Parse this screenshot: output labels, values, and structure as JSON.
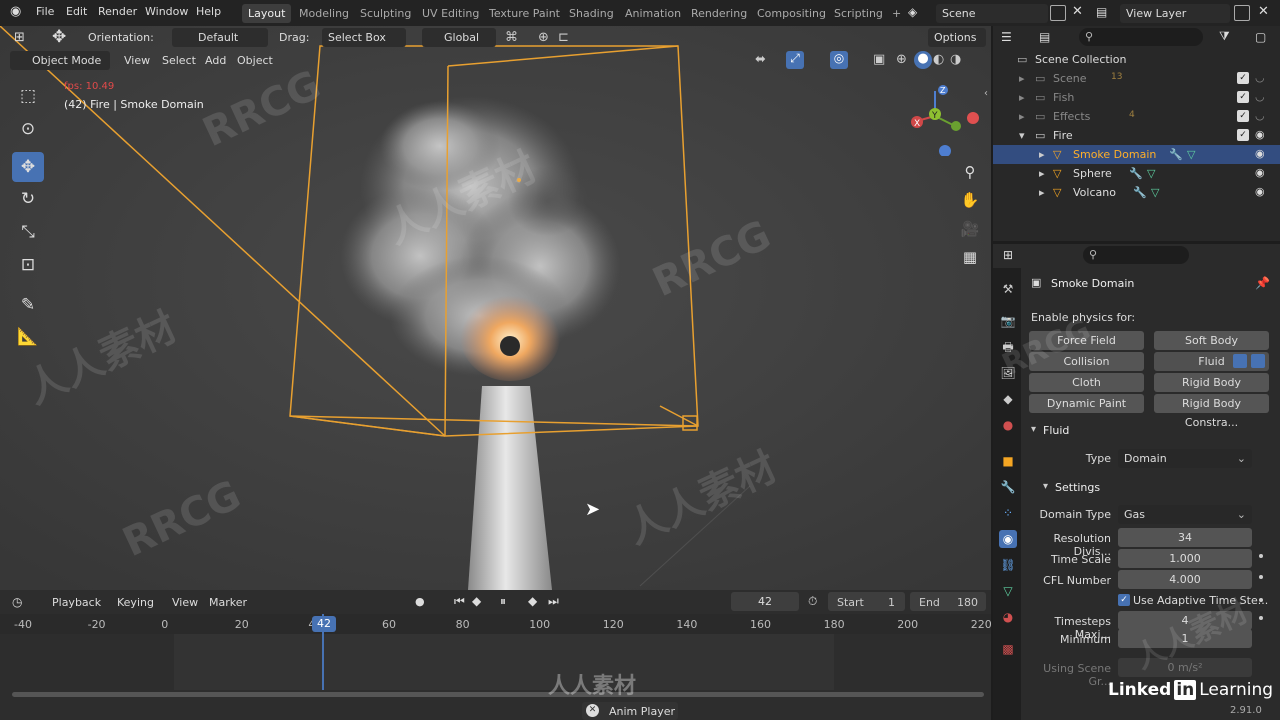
{
  "topbar": {
    "menus": [
      "File",
      "Edit",
      "Render",
      "Window",
      "Help"
    ],
    "workspaces": [
      "Layout",
      "Modeling",
      "Sculpting",
      "UV Editing",
      "Texture Paint",
      "Shading",
      "Animation",
      "Rendering",
      "Compositing",
      "Scripting"
    ],
    "add_label": "+",
    "scene_label": "Scene",
    "viewlayer_label": "View Layer"
  },
  "viewport": {
    "orientation_label": "Orientation:",
    "orientation_value": "Default",
    "drag_label": "Drag:",
    "drag_value": "Select Box",
    "transform_value": "Global",
    "options_label": "Options",
    "mode_label": "Object Mode",
    "menus": [
      "View",
      "Select",
      "Add",
      "Object"
    ],
    "fps_text": "fps: 10.49",
    "object_info": "(42) Fire | Smoke Domain",
    "gizmo": {
      "x": "X",
      "y": "Y",
      "z": "Z"
    }
  },
  "outliner": {
    "search_placeholder": "",
    "rows": [
      {
        "label": "Scene Collection",
        "dim": false,
        "indent": 0
      },
      {
        "label": "Scene",
        "dim": true,
        "indent": 1,
        "badge": "13"
      },
      {
        "label": "Fish",
        "dim": true,
        "indent": 1
      },
      {
        "label": "Effects",
        "dim": true,
        "indent": 1,
        "badge": "4"
      },
      {
        "label": "Fire",
        "dim": false,
        "indent": 1
      },
      {
        "label": "Smoke Domain",
        "dim": false,
        "indent": 2,
        "selected": true
      },
      {
        "label": "Sphere",
        "dim": false,
        "indent": 2
      },
      {
        "label": "Volcano",
        "dim": false,
        "indent": 2
      }
    ]
  },
  "properties": {
    "object_name": "Smoke Domain",
    "enable_physics_label": "Enable physics for:",
    "physics_buttons": [
      "Force Field",
      "Soft Body",
      "Collision",
      "Fluid",
      "Cloth",
      "Rigid Body",
      "Dynamic Paint",
      "Rigid Body Constra..."
    ],
    "fluid_section": "Fluid",
    "type_label": "Type",
    "type_value": "Domain",
    "settings_section": "Settings",
    "domain_type_label": "Domain Type",
    "domain_type_value": "Gas",
    "resolution_label": "Resolution Divis...",
    "resolution_value": "34",
    "time_scale_label": "Time Scale",
    "time_scale_value": "1.000",
    "cfl_label": "CFL Number",
    "cfl_value": "4.000",
    "adaptive_label": "Use Adaptive Time Ste...",
    "timesteps_max_label": "Timesteps Maxi...",
    "timesteps_max_value": "4",
    "minimum_label": "Minimum",
    "minimum_value": "1",
    "gravity_label": "Using Scene Gr...",
    "gravity_value": "0 m/s²"
  },
  "timeline": {
    "playback_label": "Playback",
    "keying_label": "Keying",
    "view_label": "View",
    "marker_label": "Marker",
    "current_frame": "42",
    "start_label": "Start",
    "start_value": "1",
    "end_label": "End",
    "end_value": "180",
    "ticks": [
      "-40",
      "-20",
      "0",
      "20",
      "40",
      "60",
      "80",
      "100",
      "120",
      "140",
      "160",
      "180",
      "200",
      "220"
    ],
    "playhead_label": "42"
  },
  "statusbar": {
    "anim_player_label": "Anim Player",
    "version": "2.91.0",
    "linkedin": "Linked",
    "linkedin_in": "in",
    "learning": "Learning"
  },
  "watermarks": [
    "RRCG",
    "人人素材"
  ],
  "colors": {
    "accent": "#4772b3",
    "selection_orange": "#f5a623",
    "fps_red": "#e04a4a"
  }
}
